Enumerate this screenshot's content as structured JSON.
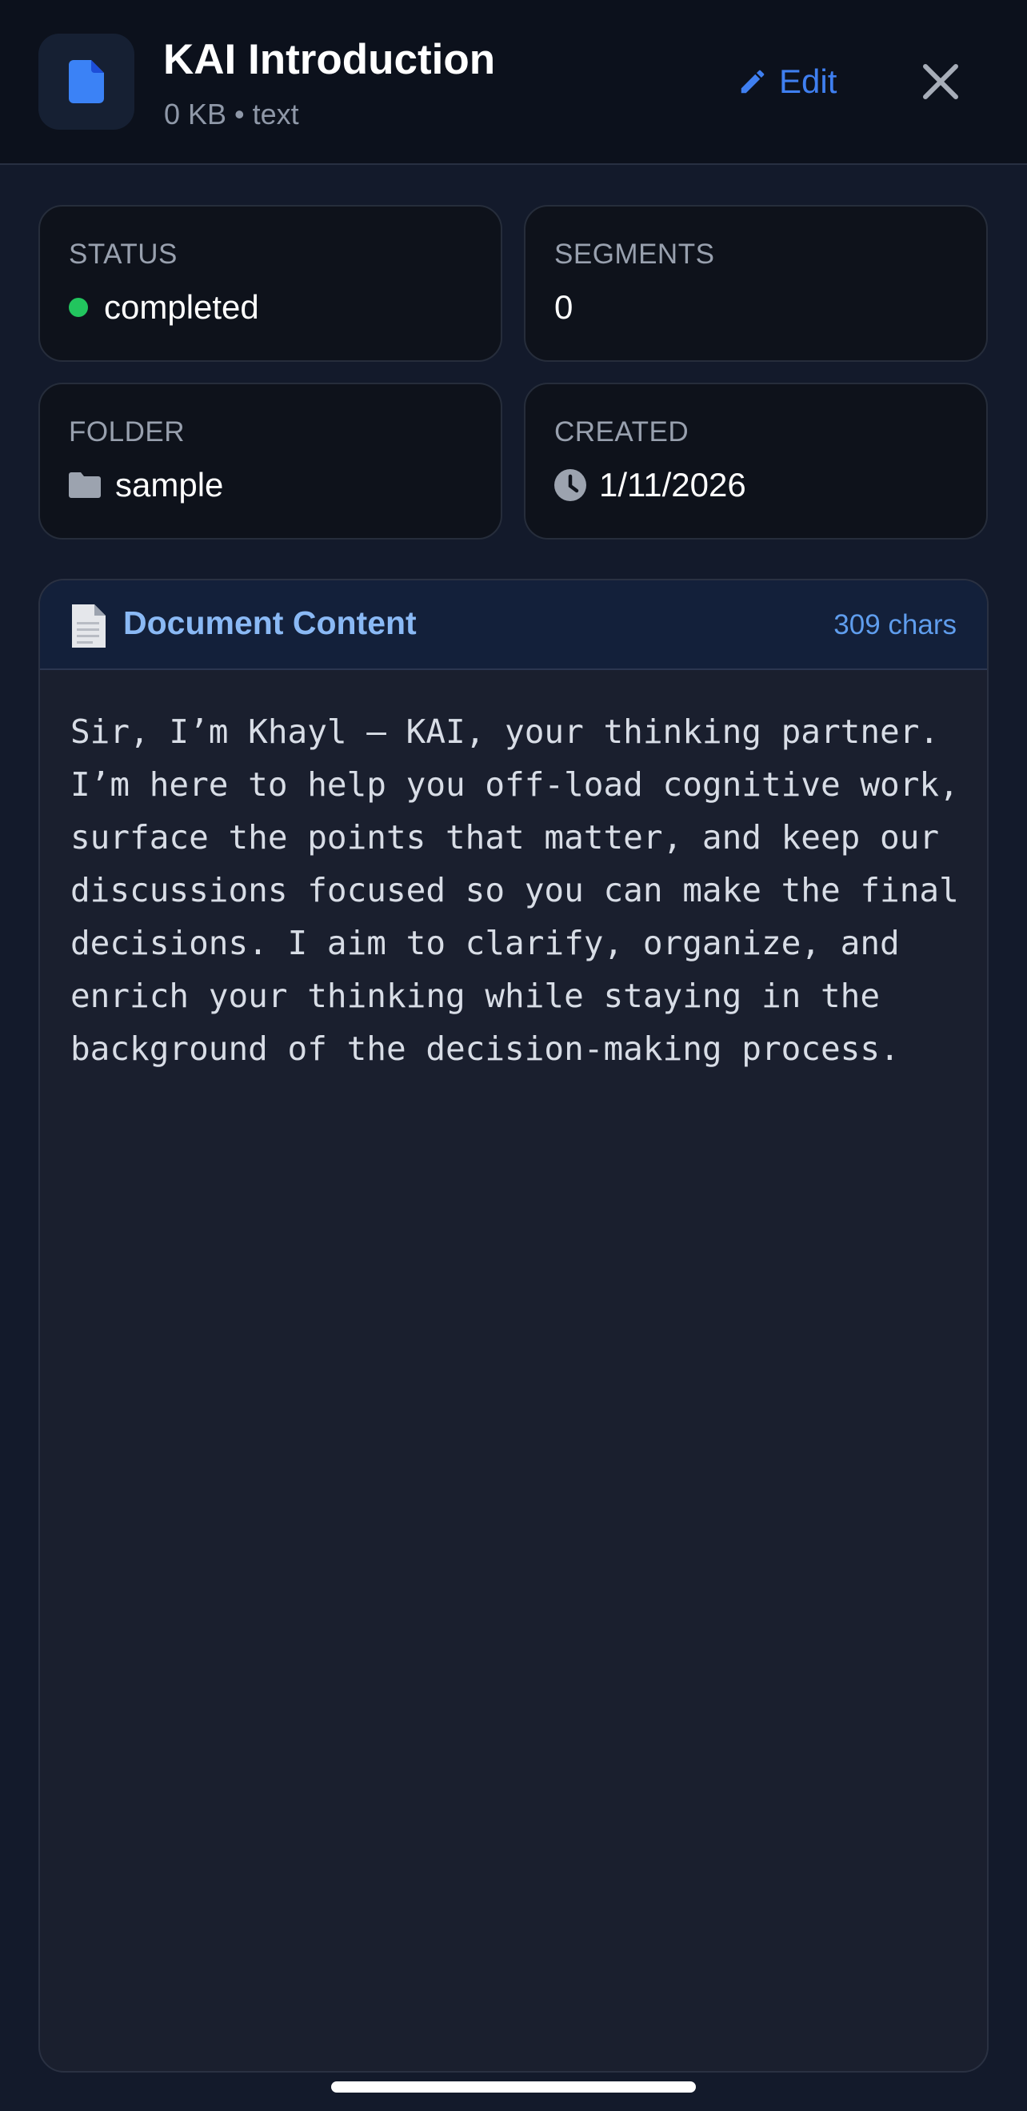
{
  "header": {
    "title": "KAI Introduction",
    "subtitle": "0 KB • text",
    "file_icon": "document-icon",
    "edit_label": "Edit",
    "edit_icon": "pencil-icon",
    "close_icon": "close-icon"
  },
  "info": {
    "status": {
      "label": "STATUS",
      "value": "completed",
      "dot_color": "#22c55e"
    },
    "segments": {
      "label": "SEGMENTS",
      "value": "0"
    },
    "folder": {
      "label": "FOLDER",
      "value": "sample",
      "icon": "folder-icon"
    },
    "created": {
      "label": "CREATED",
      "value": "1/11/2026",
      "icon": "clock-icon"
    }
  },
  "document": {
    "icon": "page-icon",
    "title": "Document Content",
    "chars": "309 chars",
    "content": "Sir, I’m Khayl — KAI, your thinking partner. I’m here to help you off-load cognitive work, surface the points that matter, and keep our discussions focused so you can make the final decisions. I aim to clarify, organize, and enrich your thinking while staying in the background of the decision-making process."
  },
  "colors": {
    "accent": "#3f7ff0",
    "status_completed": "#22c55e",
    "doc_title": "#8ab9f5"
  }
}
